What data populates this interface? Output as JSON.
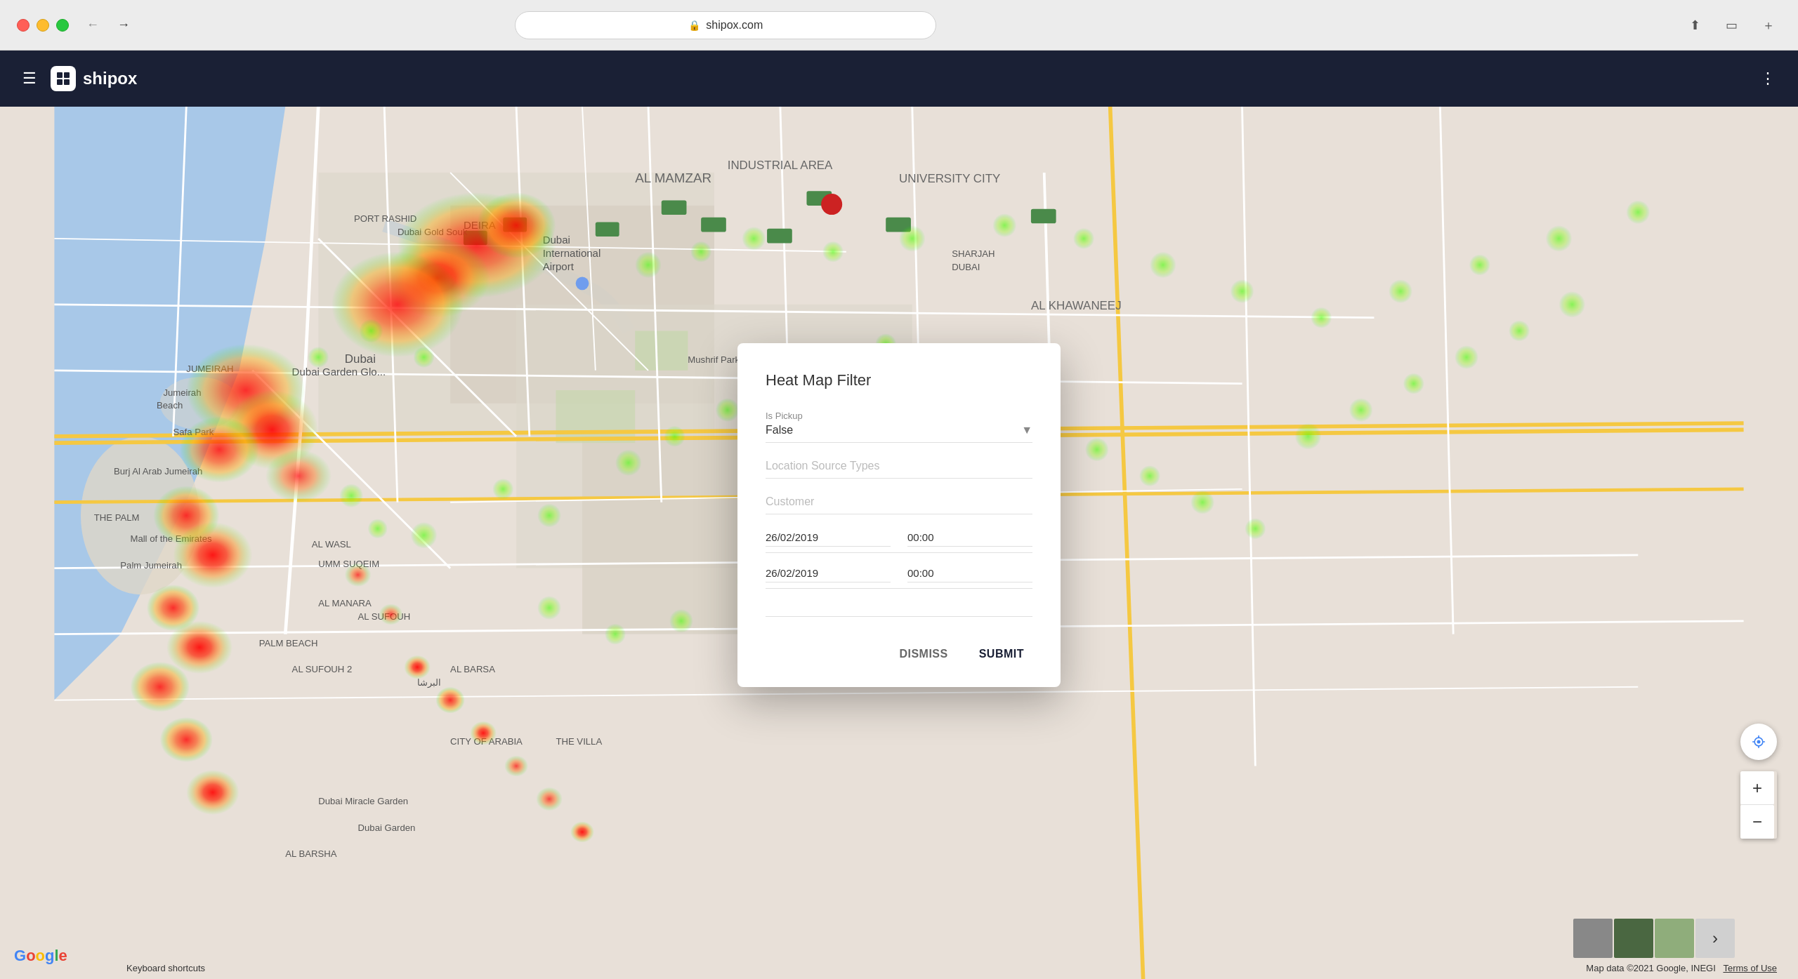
{
  "browser": {
    "url": "shipox.com",
    "back_btn": "←",
    "forward_btn": "→"
  },
  "header": {
    "app_name": "shipox",
    "hamburger_label": "☰",
    "menu_dots_label": "⋮"
  },
  "modal": {
    "title": "Heat Map Filter",
    "is_pickup_label": "Is Pickup",
    "is_pickup_value": "False",
    "location_source_types_label": "Location Source Types",
    "location_source_types_placeholder": "Location Source Types",
    "customer_label": "Customer",
    "customer_placeholder": "Customer",
    "date_from": "26/02/2019",
    "time_from": "00:00",
    "date_to": "26/02/2019",
    "time_to": "00:00",
    "dismiss_btn": "DISMISS",
    "submit_btn": "SUBMIT"
  },
  "map": {
    "google_brand": "Google",
    "copyright": "Map data ©2021 Google, INEGI",
    "terms": "Terms of Use",
    "keyboard_shortcuts": "Keyboard shortcuts",
    "zoom_in": "+",
    "zoom_out": "−"
  },
  "map_controls": {
    "location_btn": "⊕",
    "zoom_in": "+",
    "zoom_out": "−",
    "expand_btn": "⤢"
  }
}
